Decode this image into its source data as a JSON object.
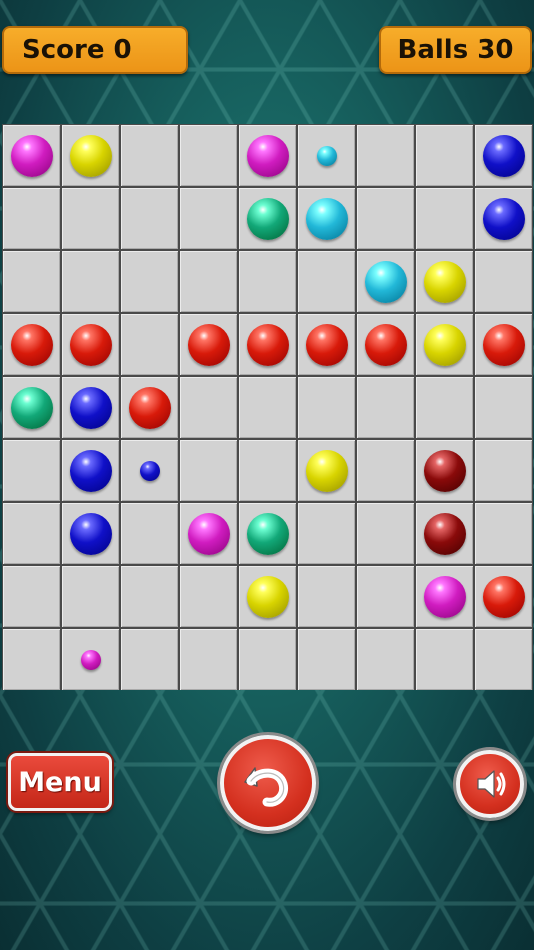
{
  "header": {
    "score_label": "Score",
    "score_value": "0",
    "balls_label": "Balls",
    "balls_value": "30"
  },
  "board": {
    "rows": 9,
    "cols": 9,
    "colors": {
      "magenta": "#d01cc0",
      "yellow": "#d8d400",
      "blue": "#1010c8",
      "cyan": "#22b8d8",
      "green": "#12a878",
      "red": "#d81a0a",
      "darkred": "#8a0a0a"
    },
    "balls": [
      {
        "row": 0,
        "col": 0,
        "color": "magenta",
        "size": "big"
      },
      {
        "row": 0,
        "col": 1,
        "color": "yellow",
        "size": "big"
      },
      {
        "row": 0,
        "col": 4,
        "color": "magenta",
        "size": "big"
      },
      {
        "row": 0,
        "col": 5,
        "color": "cyan",
        "size": "small"
      },
      {
        "row": 0,
        "col": 8,
        "color": "blue",
        "size": "big"
      },
      {
        "row": 1,
        "col": 4,
        "color": "green",
        "size": "big"
      },
      {
        "row": 1,
        "col": 5,
        "color": "cyan",
        "size": "big"
      },
      {
        "row": 1,
        "col": 8,
        "color": "blue",
        "size": "big"
      },
      {
        "row": 2,
        "col": 6,
        "color": "cyan",
        "size": "big"
      },
      {
        "row": 2,
        "col": 7,
        "color": "yellow",
        "size": "big"
      },
      {
        "row": 3,
        "col": 0,
        "color": "red",
        "size": "big"
      },
      {
        "row": 3,
        "col": 1,
        "color": "red",
        "size": "big"
      },
      {
        "row": 3,
        "col": 3,
        "color": "red",
        "size": "big"
      },
      {
        "row": 3,
        "col": 4,
        "color": "red",
        "size": "big"
      },
      {
        "row": 3,
        "col": 5,
        "color": "red",
        "size": "big"
      },
      {
        "row": 3,
        "col": 6,
        "color": "red",
        "size": "big"
      },
      {
        "row": 3,
        "col": 7,
        "color": "yellow",
        "size": "big"
      },
      {
        "row": 3,
        "col": 8,
        "color": "red",
        "size": "big"
      },
      {
        "row": 4,
        "col": 0,
        "color": "green",
        "size": "big"
      },
      {
        "row": 4,
        "col": 1,
        "color": "blue",
        "size": "big"
      },
      {
        "row": 4,
        "col": 2,
        "color": "red",
        "size": "big"
      },
      {
        "row": 5,
        "col": 1,
        "color": "blue",
        "size": "big"
      },
      {
        "row": 5,
        "col": 2,
        "color": "blue",
        "size": "small"
      },
      {
        "row": 5,
        "col": 5,
        "color": "yellow",
        "size": "big"
      },
      {
        "row": 5,
        "col": 7,
        "color": "darkred",
        "size": "big"
      },
      {
        "row": 6,
        "col": 1,
        "color": "blue",
        "size": "big"
      },
      {
        "row": 6,
        "col": 3,
        "color": "magenta",
        "size": "big"
      },
      {
        "row": 6,
        "col": 4,
        "color": "green",
        "size": "big"
      },
      {
        "row": 6,
        "col": 7,
        "color": "darkred",
        "size": "big"
      },
      {
        "row": 7,
        "col": 4,
        "color": "yellow",
        "size": "big"
      },
      {
        "row": 7,
        "col": 7,
        "color": "magenta",
        "size": "big"
      },
      {
        "row": 7,
        "col": 8,
        "color": "red",
        "size": "big"
      },
      {
        "row": 8,
        "col": 1,
        "color": "magenta",
        "size": "small"
      }
    ]
  },
  "controls": {
    "menu_label": "Menu",
    "undo_icon": "undo-arrow-icon",
    "sound_icon": "speaker-icon"
  }
}
